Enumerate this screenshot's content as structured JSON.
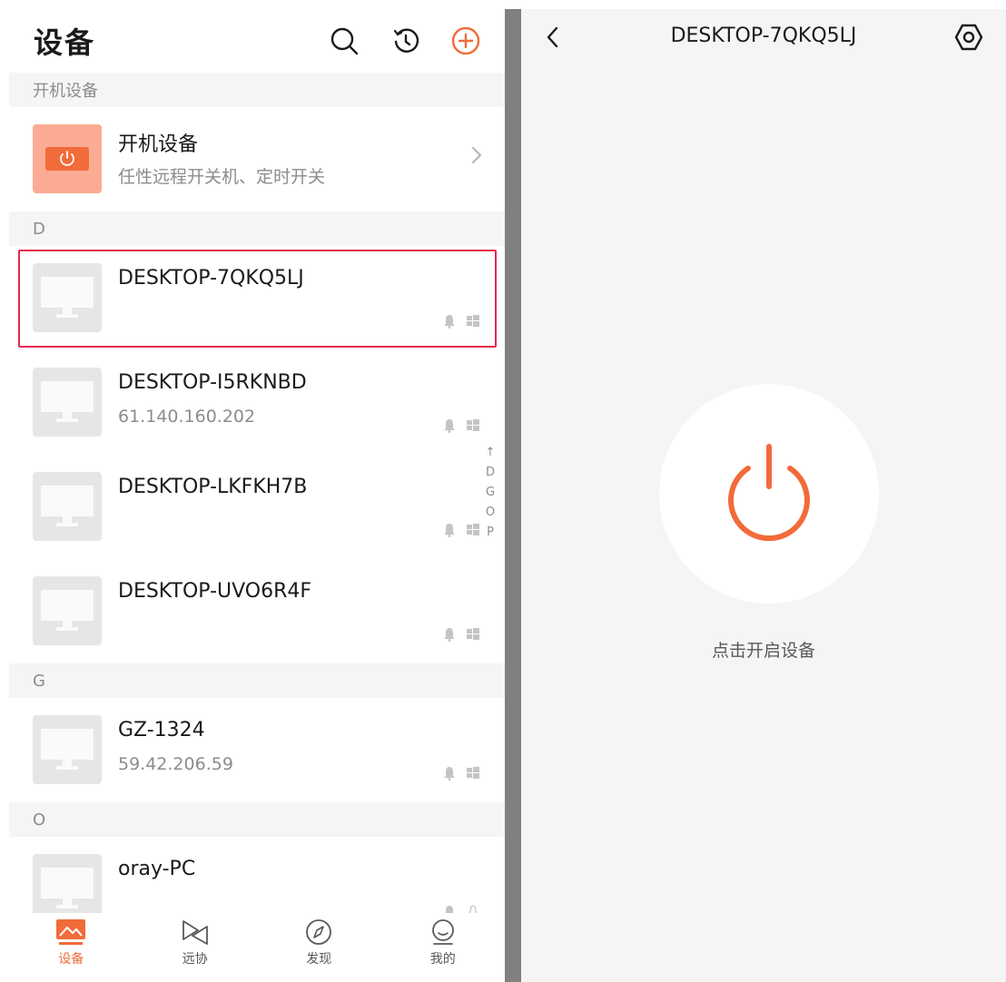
{
  "colors": {
    "accent": "#f26b3a",
    "selected_border": "#e6294f",
    "muted": "#8c8c8c"
  },
  "left": {
    "title": "设备",
    "header_icons": [
      "search-icon",
      "history-icon",
      "add-icon"
    ],
    "sections": [
      {
        "label": "开机设备"
      },
      {
        "label": "D"
      },
      {
        "label": "G"
      },
      {
        "label": "O"
      }
    ],
    "power_device": {
      "name": "开机设备",
      "desc": "任性远程开关机、定时开关"
    },
    "devices": [
      {
        "name": "DESKTOP-7QKQ5LJ",
        "ip": "",
        "os": "windows",
        "selected": true
      },
      {
        "name": "DESKTOP-I5RKNBD",
        "ip": "61.140.160.202",
        "os": "windows"
      },
      {
        "name": "DESKTOP-LKFKH7B",
        "ip": "",
        "os": "windows"
      },
      {
        "name": "DESKTOP-UVO6R4F",
        "ip": "",
        "os": "windows"
      },
      {
        "name": "GZ-1324",
        "ip": "59.42.206.59",
        "os": "windows"
      },
      {
        "name": "oray-PC",
        "ip": "",
        "os": "linux"
      }
    ],
    "index_bar": {
      "arrow": "↑",
      "letters": [
        "D",
        "G",
        "O",
        "P"
      ]
    },
    "tabs": [
      {
        "label": "设备",
        "icon": "devices-icon",
        "active": true
      },
      {
        "label": "远协",
        "icon": "remote-assist-icon"
      },
      {
        "label": "发现",
        "icon": "compass-icon"
      },
      {
        "label": "我的",
        "icon": "profile-icon"
      }
    ]
  },
  "right": {
    "title": "DESKTOP-7QKQ5LJ",
    "hint": "点击开启设备"
  }
}
